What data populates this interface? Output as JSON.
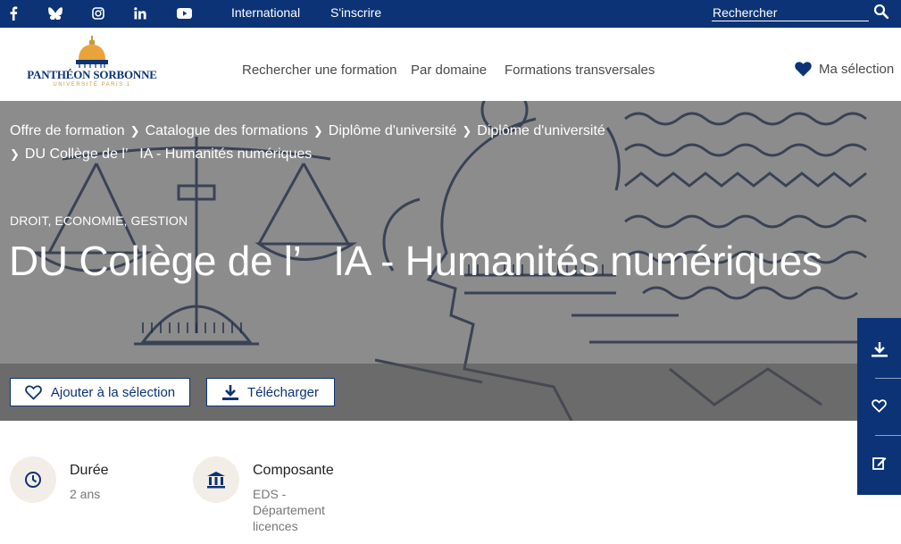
{
  "topbar": {
    "social": [
      "facebook-icon",
      "bluesky-icon",
      "instagram-icon",
      "linkedin-icon",
      "youtube-icon"
    ],
    "links": [
      "International",
      "S'inscrire"
    ],
    "search_placeholder": "Rechercher"
  },
  "header": {
    "logo_name": "PANTHÉON SORBONNE",
    "logo_sub": "UNIVERSITÉ PARIS 1",
    "nav": [
      "Rechercher une formation",
      "Par domaine",
      "Formations transversales"
    ],
    "favorites": "Ma sélection"
  },
  "hero": {
    "breadcrumbs": [
      "Offre de formation",
      "Catalogue des formations",
      "Diplôme d'université",
      "Diplôme d'université"
    ],
    "breadcrumb_last": "DU Collège de l’   IA - Humanités numériques",
    "kicker": "DROIT, ECONOMIE, GESTION",
    "title": "DU Collège de l’   IA - Humanités numériques",
    "add_button": "Ajouter à la sélection",
    "download_button": "Télécharger"
  },
  "info": {
    "duration_label": "Durée",
    "duration_value": "2 ans",
    "component_label": "Composante",
    "component_value": [
      "EDS -",
      "Département",
      "licences"
    ]
  },
  "colors": {
    "primary": "#0b3376",
    "accent": "#c89a3a",
    "icon_bg": "#f3ede7"
  }
}
